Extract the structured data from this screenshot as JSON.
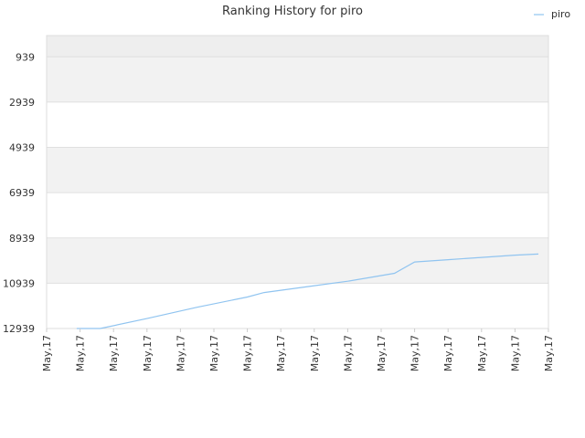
{
  "chart_data": {
    "type": "line",
    "title": "Ranking History for piro",
    "xlabel": "",
    "ylabel": "",
    "y_inverted": true,
    "ylim": [
      12939,
      0
    ],
    "y_ticks": [
      939,
      2939,
      4939,
      6939,
      8939,
      10939,
      12939
    ],
    "x_tick_labels": [
      "May,17",
      "May,17",
      "May,17",
      "May,17",
      "May,17",
      "May,17",
      "May,17",
      "May,17",
      "May,17",
      "May,17",
      "May,17",
      "May,17",
      "May,17",
      "May,17",
      "May,17",
      "May,17"
    ],
    "grid": true,
    "legend_position": "top-right",
    "series": [
      {
        "name": "piro",
        "color": "#90c4f0",
        "x_index": [
          0.9,
          1.6,
          3.0,
          4.5,
          6.0,
          6.5,
          7.0,
          8.0,
          9.0,
          10.0,
          10.4,
          11.0,
          12.0,
          13.0,
          14.0,
          14.7
        ],
        "values": [
          12939,
          12939,
          12500,
          12000,
          11550,
          11350,
          11250,
          11050,
          10850,
          10600,
          10500,
          10000,
          9900,
          9800,
          9700,
          9650
        ]
      }
    ]
  }
}
